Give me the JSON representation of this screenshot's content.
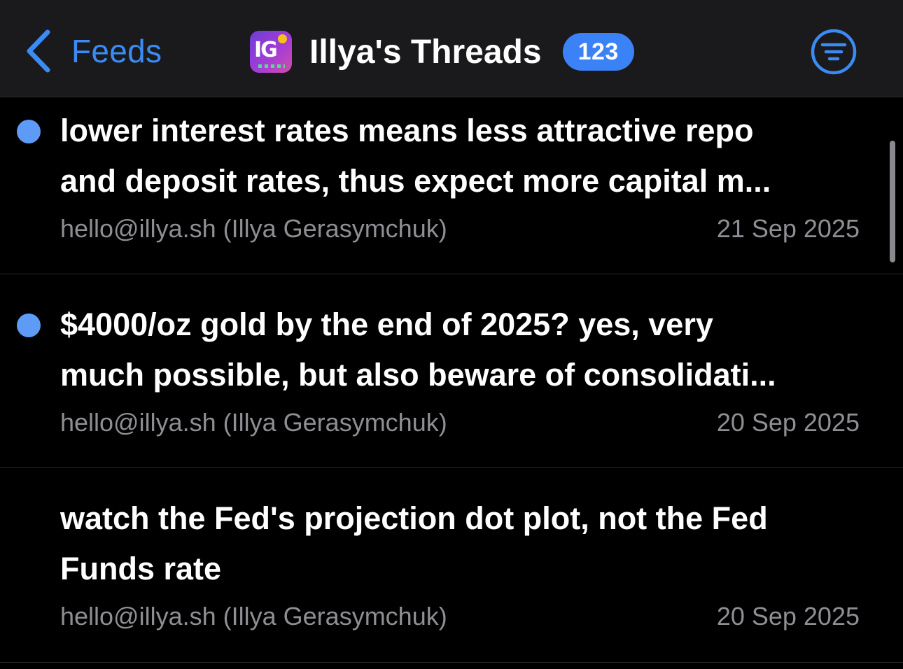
{
  "nav": {
    "back_label": "Feeds",
    "back_icon": "chevron-left-icon"
  },
  "feed": {
    "logo_text": "IG",
    "title": "Illya's Threads",
    "unread_count": "123",
    "filter_icon": "filter-lines-icon"
  },
  "colors": {
    "accent": "#3b8bf5",
    "badge": "#3b82f6",
    "unread_dot": "#5d9bf7",
    "header_bg": "#1a1a1c",
    "background": "#000000",
    "meta_text": "#8e8e93"
  },
  "articles": [
    {
      "title_line1": "lower interest rates means less attractive repo",
      "title_line2": "and deposit rates, thus expect more capital m...",
      "author": "hello@illya.sh (Illya Gerasymchuk)",
      "date": "21 Sep 2025",
      "unread": true
    },
    {
      "title_line1": "$4000/oz gold by the end of 2025? yes, very",
      "title_line2": "much possible, but also beware of consolidati...",
      "author": "hello@illya.sh (Illya Gerasymchuk)",
      "date": "20 Sep 2025",
      "unread": true
    },
    {
      "title_line1": "watch the Fed's projection dot plot, not the Fed",
      "title_line2": "Funds rate",
      "author": "hello@illya.sh (Illya Gerasymchuk)",
      "date": "20 Sep 2025",
      "unread": false
    }
  ]
}
